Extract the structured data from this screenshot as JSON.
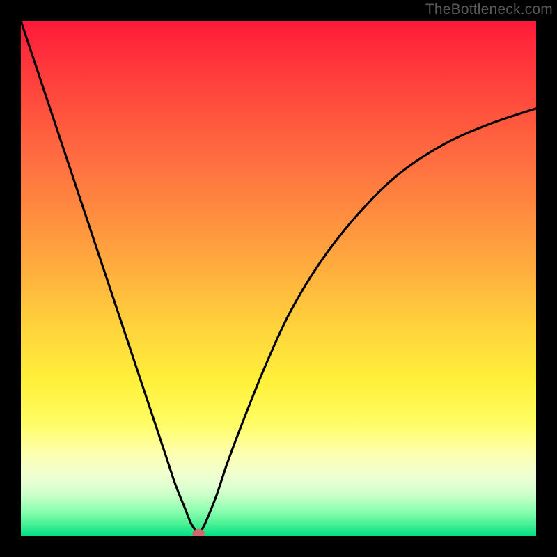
{
  "watermark": {
    "text": "TheBottleneck.com"
  },
  "colors": {
    "frame": "#000000",
    "curve_stroke": "#000000",
    "marker_fill": "#cd6b6b",
    "gradient_top": "#ff1a3a",
    "gradient_bottom": "#00e080"
  },
  "chart_data": {
    "type": "line",
    "title": "",
    "xlabel": "",
    "ylabel": "",
    "xlim": [
      0,
      100
    ],
    "ylim": [
      0,
      100
    ],
    "grid": false,
    "legend": false,
    "notes": "Axes unlabeled; values are fractional positions read off the image (0 = left/bottom, 100 = right/top). Curve is a bottleneck-style V with minimum near x≈34.5.",
    "series": [
      {
        "name": "bottleneck-curve",
        "x": [
          0,
          5,
          10,
          15,
          20,
          25,
          28,
          30,
          32,
          33,
          34,
          34.5,
          35,
          36,
          38,
          40,
          43,
          47,
          52,
          58,
          65,
          73,
          82,
          91,
          100
        ],
        "values": [
          100,
          85,
          70,
          55,
          40,
          25,
          16,
          10,
          5,
          2.5,
          1,
          0.5,
          1,
          3,
          8,
          14,
          22,
          32,
          43,
          53,
          62,
          70,
          76,
          80,
          83
        ]
      }
    ],
    "marker": {
      "x": 34.5,
      "y": 0.5
    }
  }
}
